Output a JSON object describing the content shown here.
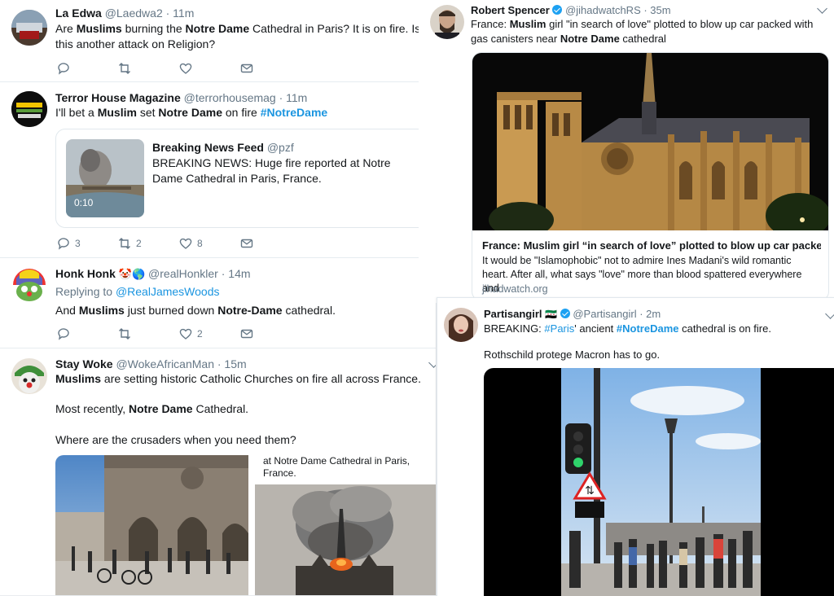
{
  "tweets": {
    "laedwa": {
      "name": "La Edwa",
      "handle": "@Laedwa2 · 11m",
      "text_parts": [
        "Are ",
        "Muslims",
        " burning the ",
        "Notre Dame",
        " Cathedral in Paris? It is on fire. Is this another attack on Religion?"
      ]
    },
    "terror": {
      "name": "Terror House Magazine",
      "handle": "@terrorhousemag · 11m",
      "text_parts": [
        "I'll bet a ",
        "Muslim",
        " set ",
        "Notre Dame",
        " on fire ",
        "#NotreDame"
      ],
      "quote": {
        "name": "Breaking News Feed",
        "handle": "@pzf",
        "text": "BREAKING NEWS: Huge fire reported at Notre Dame Cathedral in Paris, France.",
        "duration": "0:10"
      },
      "replies": "3",
      "retweets": "2",
      "likes": "8"
    },
    "honk": {
      "name": "Honk Honk",
      "handle": "@realHonkler · 14m",
      "emoji": "🤡🌎",
      "replying_prefix": "Replying to",
      "replying_to": "@RealJamesWoods",
      "text_parts": [
        "And ",
        "Muslims",
        " just burned down ",
        "Notre-Dame",
        " cathedral."
      ],
      "likes": "2"
    },
    "staywoke": {
      "name": "Stay Woke",
      "handle": "@WokeAfricanMan · 15m",
      "line1_parts": [
        "Muslims",
        " are setting historic Catholic Churches on fire all across France."
      ],
      "line2_parts": [
        "Most recently, ",
        "Notre Dame",
        " Cathedral."
      ],
      "line3": "Where are the crusaders when you need them?",
      "caption": "at Notre Dame Cathedral in Paris, France."
    },
    "spencer": {
      "name": "Robert Spencer",
      "handle": "@jihadwatchRS · 35m",
      "text_parts": [
        "France: ",
        "Muslim",
        " girl \"in search of love\" plotted to blow up car packed with gas canisters near ",
        "Notre Dame",
        " cathedral"
      ],
      "card": {
        "title": "France: Muslim girl “in search of love” plotted to blow up car packed ...",
        "desc": "It would be \"Islamophobic\" not to admire Ines Madani's wild romantic heart. After all, what says \"love\" more than blood spattered everywhere and",
        "domain": "jihadwatch.org"
      }
    },
    "partisan": {
      "name": "Partisangirl",
      "flag": "🇸🇾",
      "handle": "@Partisangirl · 2m",
      "text_parts": [
        "BREAKING:  ",
        "#Paris",
        "' ancient ",
        "#NotreDame",
        " cathedral is on fire."
      ],
      "line2": "Rothschild protege Macron has to go."
    }
  }
}
